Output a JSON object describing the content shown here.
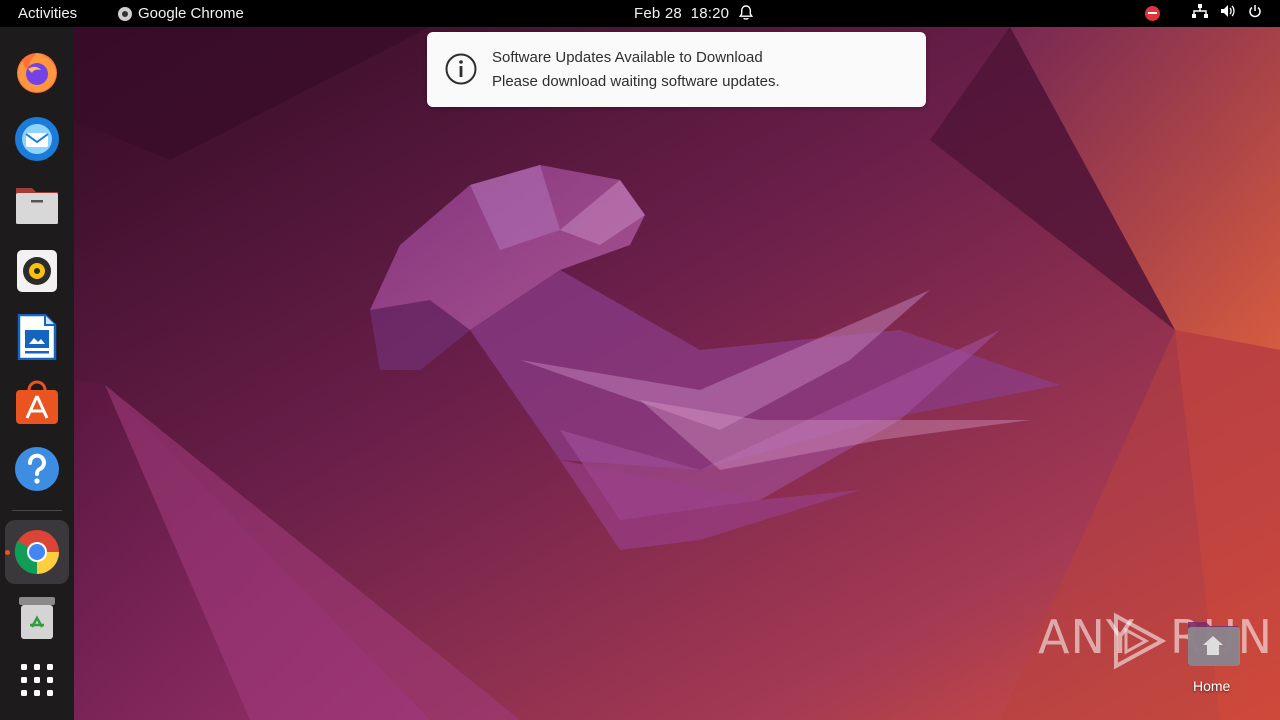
{
  "topbar": {
    "activities": "Activities",
    "app_name": "Google Chrome",
    "date": "Feb 28",
    "time": "18:20"
  },
  "notification": {
    "title": "Software Updates Available to Download",
    "body": "Please download waiting software updates."
  },
  "dock": {
    "items": [
      {
        "name": "firefox",
        "icon": "firefox-icon"
      },
      {
        "name": "thunderbird",
        "icon": "thunderbird-icon"
      },
      {
        "name": "files",
        "icon": "files-icon"
      },
      {
        "name": "rhythmbox",
        "icon": "rhythmbox-icon"
      },
      {
        "name": "libreoffice-writer",
        "icon": "writer-icon"
      },
      {
        "name": "software",
        "icon": "app-center-icon"
      },
      {
        "name": "help",
        "icon": "help-icon"
      },
      {
        "name": "google-chrome",
        "icon": "chrome-icon",
        "running": true
      },
      {
        "name": "trash",
        "icon": "trash-icon"
      },
      {
        "name": "show-apps",
        "icon": "app-grid-icon"
      }
    ]
  },
  "desktop": {
    "home_label": "Home",
    "watermark_left": "ANY",
    "watermark_right": "RUN"
  },
  "colors": {
    "accent": "#e95420",
    "dock_bg": "#1d1b1c",
    "topbar_bg": "#000000",
    "notification_bg": "#fafafa"
  }
}
